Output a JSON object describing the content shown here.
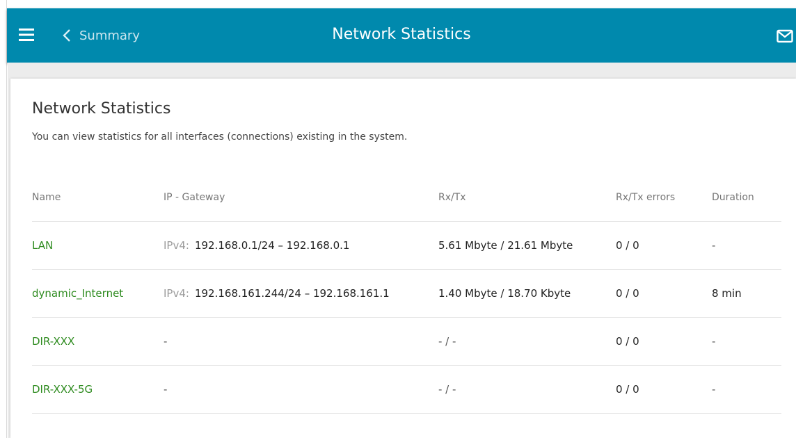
{
  "header": {
    "back_label": "Summary",
    "title": "Network Statistics",
    "menu_icon": "hamburger-menu-icon",
    "back_icon": "chevron-left-icon",
    "mail_icon": "mail-icon",
    "color": "#0089ad"
  },
  "card": {
    "title": "Network Statistics",
    "description": "You can view statistics for all interfaces (connections) existing in the system."
  },
  "table": {
    "columns": [
      "Name",
      "IP - Gateway",
      "Rx/Tx",
      "Rx/Tx errors",
      "Duration"
    ],
    "rows": [
      {
        "name": "LAN",
        "ip_tag": "IPv4:",
        "ip": "192.168.0.1/24 – 192.168.0.1",
        "rxtx": "5.61 Mbyte / 21.61 Mbyte",
        "errors": "0 / 0",
        "duration": "-"
      },
      {
        "name": "dynamic_Internet",
        "ip_tag": "IPv4:",
        "ip": "192.168.161.244/24 – 192.168.161.1",
        "rxtx": "1.40 Mbyte / 18.70 Kbyte",
        "errors": "0 / 0",
        "duration": "8 min"
      },
      {
        "name": "DIR-XXX",
        "ip_tag": "",
        "ip": "-",
        "rxtx": "- / -",
        "errors": "0 / 0",
        "duration": "-"
      },
      {
        "name": "DIR-XXX-5G",
        "ip_tag": "",
        "ip": "-",
        "rxtx": "- / -",
        "errors": "0 / 0",
        "duration": "-"
      }
    ]
  }
}
